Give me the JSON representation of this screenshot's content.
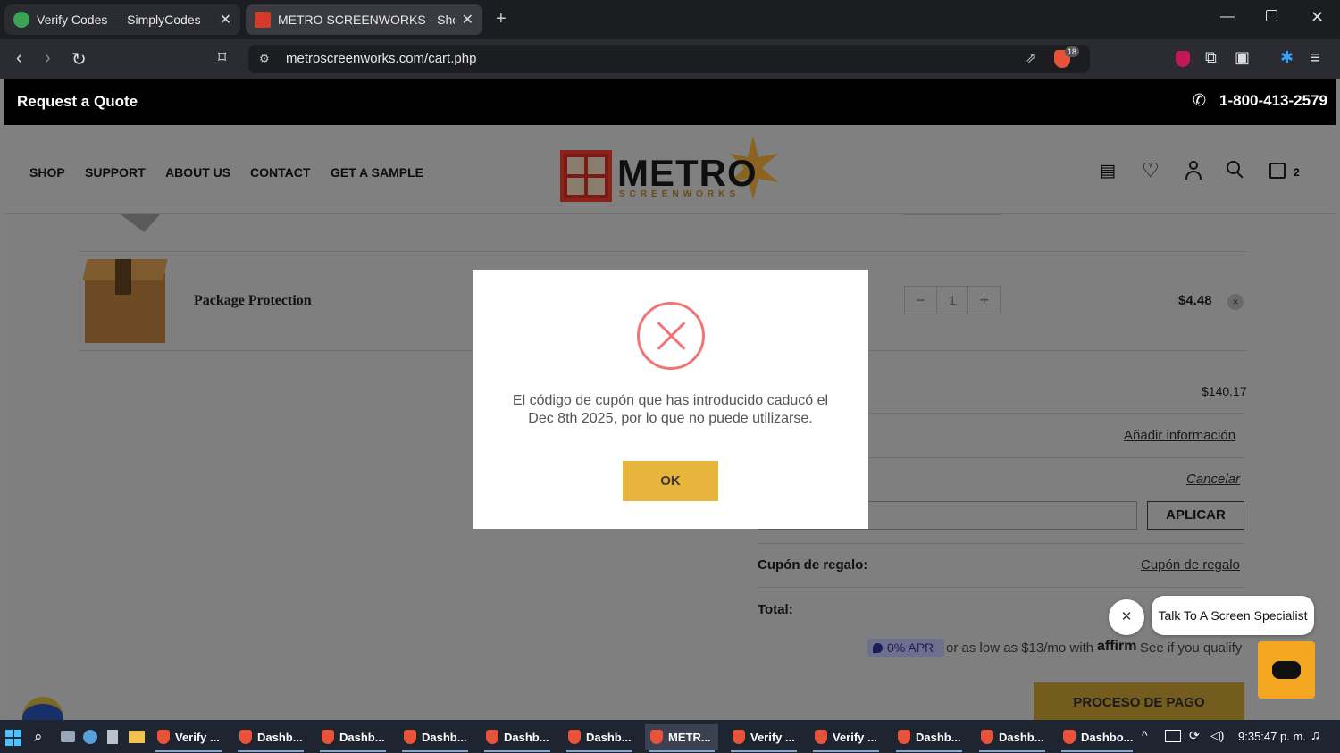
{
  "browser": {
    "tabs": [
      {
        "label": "Verify Codes — SimplyCodes",
        "close": "✕"
      },
      {
        "label": "METRO SCREENWORKS - Shopp",
        "close": "✕"
      }
    ],
    "new_tab": "+",
    "url": "metroscreenworks.com/cart.php",
    "brave_badge": "18"
  },
  "topbar": {
    "quote": "Request a Quote",
    "phone": "1-800-413-2579"
  },
  "nav": {
    "items": [
      "SHOP",
      "SUPPORT",
      "ABOUT US",
      "CONTACT",
      "GET A SAMPLE"
    ],
    "logo_main": "METRO",
    "logo_sub": "SCREENWORKS",
    "cart_count": "2"
  },
  "cart": {
    "item_name": "Package Protection",
    "qty": "1",
    "qty_minus": "−",
    "qty_plus": "+",
    "price": "$4.48",
    "remove": "×",
    "subtotal": "$140.17",
    "add_info": "Añadir información",
    "coupon_label": ":",
    "coupon_cancel": "Cancelar",
    "apply": "APLICAR",
    "gift_label": "Cupón de regalo:",
    "gift_link": "Cupón de regalo",
    "total_label": "Total:",
    "affirm_apr": "0% APR",
    "affirm_text": "or as low as $13/mo with",
    "affirm_brand": "affirm",
    "affirm_cta": "See if you qualify",
    "checkout": "PROCESO DE PAGO"
  },
  "chat": {
    "bubble": "Talk To A Screen Specialist",
    "close": "✕"
  },
  "modal": {
    "message": "El código de cupón que has introducido caducó el Dec 8th 2025, por lo que no puede utilizarse.",
    "ok": "OK"
  },
  "taskbar": {
    "items": [
      "Verify ...",
      "Dashb...",
      "Dashb...",
      "Dashb...",
      "Dashb...",
      "Dashb...",
      "METR...",
      "Verify ...",
      "Verify ...",
      "Dashb...",
      "Dashb...",
      "Dashbo..."
    ],
    "time": "9:35:47 p. m."
  },
  "colors": {
    "accent": "#e8b53c",
    "error": "#f27474",
    "overlay": "#7f7f7f"
  }
}
